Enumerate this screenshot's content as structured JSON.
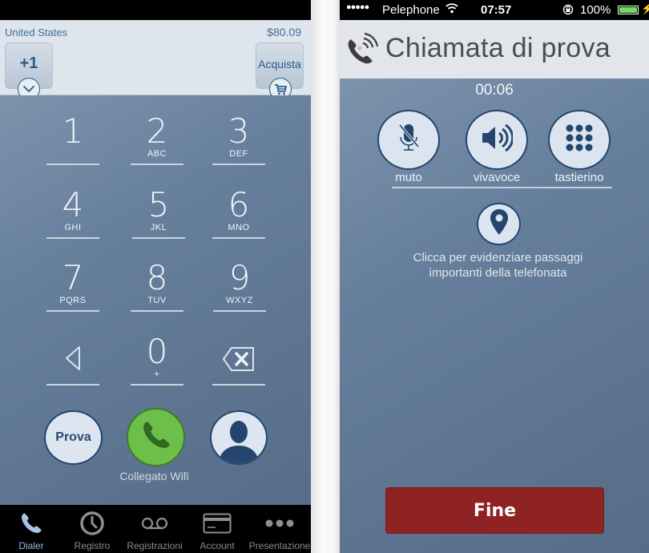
{
  "dialer_screen": {
    "header": {
      "country": "United States",
      "balance": "$80.09",
      "prefix_button": "+1",
      "buy_button": "Acquista",
      "prefix_dropdown_icon": "chevron-down-icon",
      "cart_icon": "shopping-cart-icon"
    },
    "keypad": [
      {
        "digit": "1",
        "letters": ""
      },
      {
        "digit": "2",
        "letters": "ABC"
      },
      {
        "digit": "3",
        "letters": "DEF"
      },
      {
        "digit": "4",
        "letters": "GHI"
      },
      {
        "digit": "5",
        "letters": "JKL"
      },
      {
        "digit": "6",
        "letters": "MNO"
      },
      {
        "digit": "7",
        "letters": "PQRS"
      },
      {
        "digit": "8",
        "letters": "TUV"
      },
      {
        "digit": "9",
        "letters": "WXYZ"
      },
      {
        "digit": "",
        "letters": "",
        "icon": "triangle-left-icon"
      },
      {
        "digit": "0",
        "letters": "+"
      },
      {
        "digit": "",
        "letters": "",
        "icon": "backspace-icon"
      }
    ],
    "actions": {
      "test_button": "Prova",
      "call_icon": "phone-icon",
      "contacts_icon": "contact-silhouette-icon",
      "connection_status": "Collegato Wifi"
    },
    "colors": {
      "call_green": "#6cc04a",
      "accent_blue": "#2e5a86",
      "tab_active": "#9db7e0"
    },
    "tabbar": [
      {
        "label": "Dialer",
        "icon": "phone-icon",
        "active": true
      },
      {
        "label": "Registro",
        "icon": "clock-icon",
        "active": false
      },
      {
        "label": "Registrazioni",
        "icon": "voicemail-icon",
        "active": false
      },
      {
        "label": "Account",
        "icon": "credit-card-icon",
        "active": false
      },
      {
        "label": "Presentazione",
        "icon": "more-dots-icon",
        "active": false
      }
    ]
  },
  "call_screen": {
    "status_bar": {
      "signal": "●●●●●",
      "carrier": "Pelephone",
      "time": "07:57",
      "battery": "100%",
      "battery_level": 100
    },
    "title": "Chiamata di prova",
    "title_icon": "ringing-phone-icon",
    "timer": "00:06",
    "controls": [
      {
        "label": "muto",
        "icon": "mic-muted-icon"
      },
      {
        "label": "vivavoce",
        "icon": "speaker-icon"
      },
      {
        "label": "tastierino",
        "icon": "keypad-grid-icon"
      }
    ],
    "marker_icon": "location-pin-icon",
    "hint": "Clicca per evidenziare passaggi importanti della telefonata",
    "end_button": "Fine",
    "colors": {
      "end_red": "#8f2222"
    }
  }
}
